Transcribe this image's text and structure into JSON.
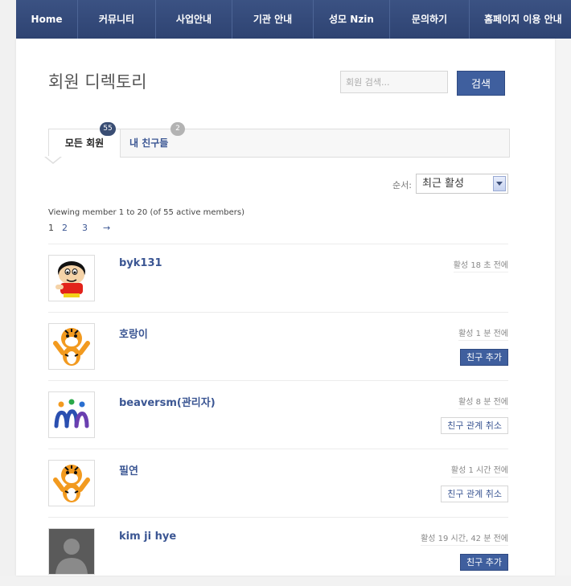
{
  "nav": {
    "items": [
      "Home",
      "커뮤니티",
      "사업안내",
      "기관 안내",
      "성모 Nzin",
      "문의하기",
      "홈페이지 이용 안내"
    ]
  },
  "page": {
    "title": "회원 디렉토리",
    "search_placeholder": "회원 검색...",
    "search_button": "검색"
  },
  "tabs": [
    {
      "label": "모든 회원",
      "badge": "55"
    },
    {
      "label": "내 친구들",
      "badge": "2"
    }
  ],
  "order": {
    "label": "순서:",
    "selected": "최근 활성"
  },
  "count_text": "Viewing member 1 to 20 (of 55 active members)",
  "pagination": {
    "current": "1",
    "pages": [
      "2",
      "3"
    ],
    "next": "→"
  },
  "members": [
    {
      "name": "byk131",
      "active": "활성 18 초 전에",
      "action": "",
      "avatar_icon": "cartoon-boy-avatar"
    },
    {
      "name": "호랑이",
      "active": "활성 1 분 전에",
      "action": "친구 추가",
      "avatar_icon": "tiger-avatar"
    },
    {
      "name": "beaversm(관리자)",
      "active": "활성 8 분 전에",
      "action": "친구 관계 취소",
      "avatar_icon": "logo-avatar"
    },
    {
      "name": "필연",
      "active": "활성 1 시간 전에",
      "action": "친구 관계 취소",
      "avatar_icon": "tiger-avatar"
    },
    {
      "name": "kim ji hye",
      "active": "활성 19 시간, 42 분 전에",
      "action": "친구 추가",
      "avatar_icon": "default-person-avatar"
    }
  ],
  "colors": {
    "nav_bg": "#34497a",
    "accent": "#3f5f9e",
    "link": "#3b5693"
  }
}
